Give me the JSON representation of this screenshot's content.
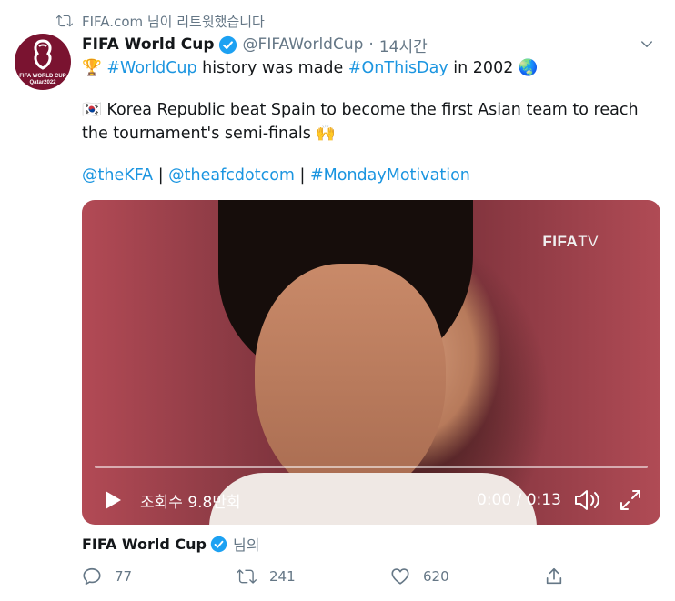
{
  "retweet": {
    "text": "FIFA.com 님이 리트윗했습니다",
    "icon": "retweet-icon"
  },
  "avatar": {
    "text_line1": "FIFA WORLD CUP",
    "text_line2": "Qatar2022",
    "bg_color": "#7a1330"
  },
  "tweet": {
    "display_name": "FIFA World Cup",
    "handle": "@FIFAWorldCup",
    "separator": "·",
    "time": "14시간",
    "line1": {
      "emoji": "🏆",
      "hashtag1": "#WorldCup",
      "text1": " history was made ",
      "hashtag2": "#OnThisDay",
      "text2": " in 2002 ",
      "emoji_end": "🌏"
    },
    "line2": {
      "emoji": "🇰🇷",
      "text": " Korea Republic beat Spain to become the first Asian team to reach"
    },
    "line3": {
      "text": "the tournament's semi-finals ",
      "emoji": "🙌"
    },
    "line4": {
      "mention1": "@theKFA",
      "sep1": " | ",
      "mention2": "@theafcdotcom",
      "sep2": " | ",
      "hashtag": "#MondayMotivation"
    }
  },
  "video": {
    "watermark_bold": "FIFA",
    "watermark_rest": "TV",
    "views": "조회수 9.8만회",
    "time_display": "0:00 / 0:13",
    "progress": 0.0
  },
  "byline": {
    "name": "FIFA World Cup",
    "suffix": "님의"
  },
  "actions": {
    "reply_count": "77",
    "retweet_count": "241",
    "like_count": "620"
  },
  "colors": {
    "link": "#1b95e0",
    "muted": "#657786",
    "verified": "#1da1f2",
    "text": "#14171a"
  }
}
